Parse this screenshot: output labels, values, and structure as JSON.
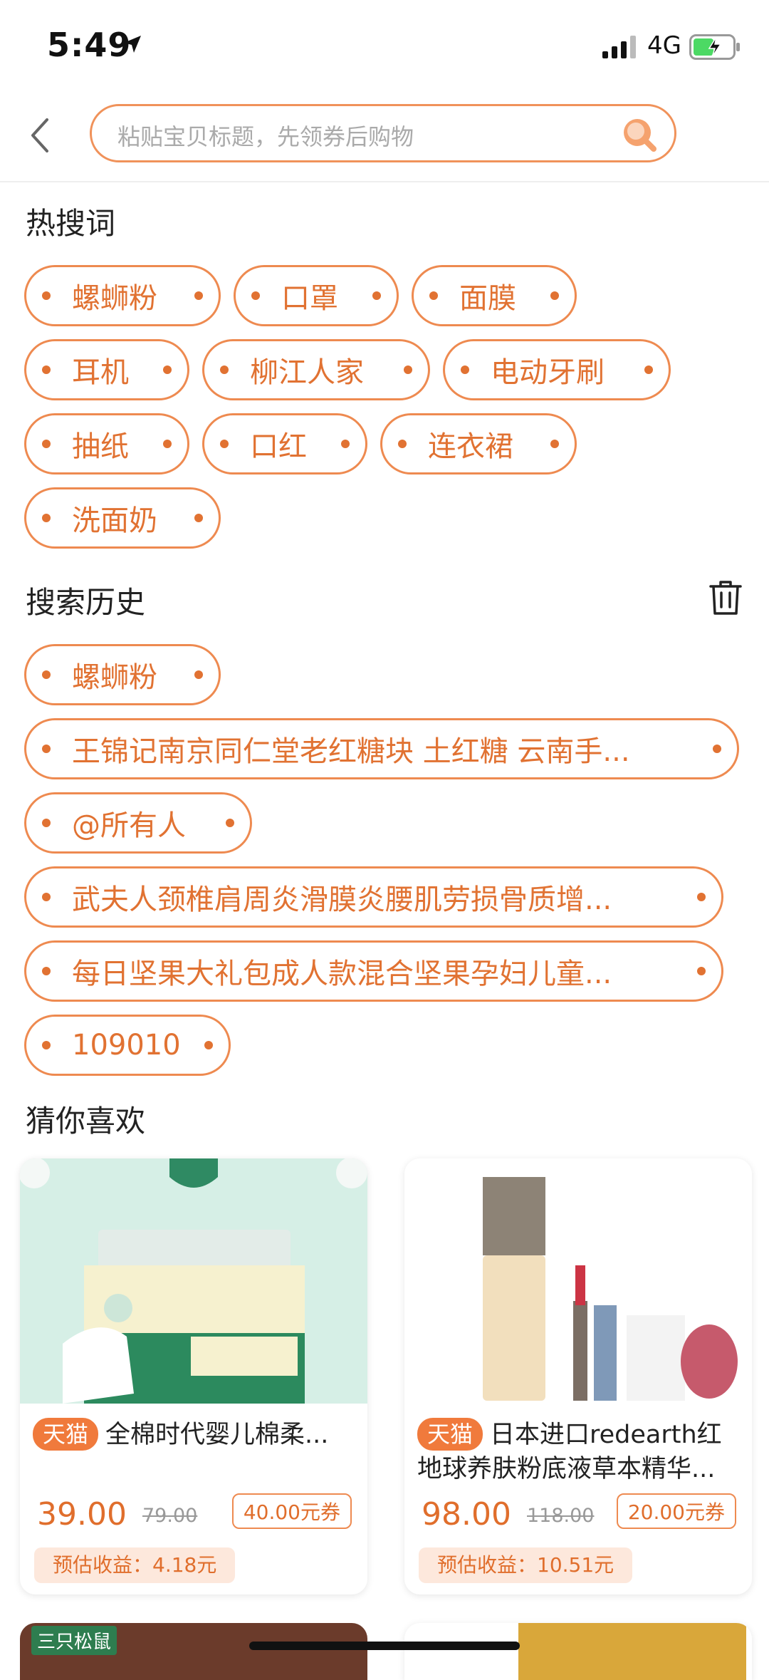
{
  "status_bar": {
    "time": "5:49",
    "network": "4G"
  },
  "search": {
    "placeholder": "粘贴宝贝标题，先领券后购物"
  },
  "hot_search": {
    "title": "热搜词",
    "items": [
      "螺蛳粉",
      "口罩",
      "面膜",
      "耳机",
      "柳江人家",
      "电动牙刷",
      "抽纸",
      "口红",
      "连衣裙",
      "洗面奶"
    ]
  },
  "history": {
    "title": "搜索历史",
    "items": [
      "螺蛳粉",
      "王锦记南京同仁堂老红糖块 土红糖 云南手...",
      "@所有人",
      "武夫人颈椎肩周炎滑膜炎腰肌劳损骨质增...",
      "每日坚果大礼包成人款混合坚果孕妇儿童...",
      "109010"
    ]
  },
  "recommend": {
    "title": "猜你喜欢",
    "products": [
      {
        "badge": "天猫",
        "title": "全棉时代婴儿棉柔...",
        "price": "39.00",
        "original_price": "79.00",
        "coupon": "40.00元券",
        "earnings": "预估收益：4.18元"
      },
      {
        "badge": "天猫",
        "title": "日本进口redearth红地球养肤粉底液草本精华...",
        "price": "98.00",
        "original_price": "118.00",
        "coupon": "20.00元券",
        "earnings": "预估收益：10.51元"
      }
    ],
    "next_row_brand": "三只松鼠"
  },
  "colors": {
    "accent": "#e17232",
    "chip_border": "#ee8a50",
    "badge": "#f07a3c",
    "earn_bg": "#fde8dc"
  },
  "icons": [
    "location-arrow-icon",
    "signal-icon",
    "battery-icon",
    "back-icon",
    "search-icon",
    "trash-icon"
  ]
}
